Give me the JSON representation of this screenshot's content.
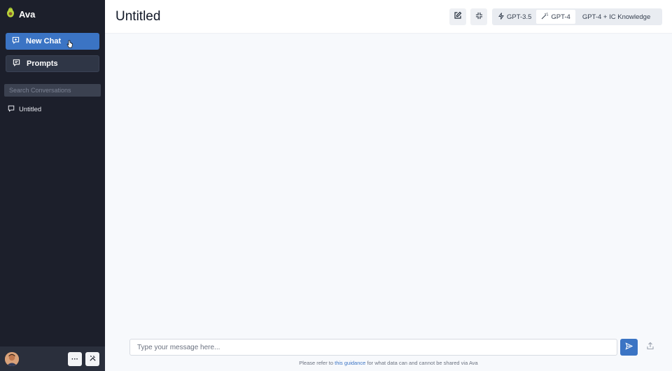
{
  "app": {
    "name": "Ava"
  },
  "sidebar": {
    "new_chat_label": "New Chat",
    "prompts_label": "Prompts",
    "search_placeholder": "Search Conversations",
    "conversations": [
      {
        "title": "Untitled"
      }
    ]
  },
  "footer": {
    "more_label": "···"
  },
  "main": {
    "title": "Untitled",
    "models": [
      {
        "label": "GPT-3.5",
        "icon": "bolt-icon",
        "active": false
      },
      {
        "label": "GPT-4",
        "icon": "magic-wand-icon",
        "active": true
      },
      {
        "label": "GPT-4 + IC Knowledge",
        "icon": "",
        "active": false
      }
    ],
    "composer_placeholder": "Type your message here...",
    "footnote_prefix": "Please refer to",
    "footnote_link": "this guidance",
    "footnote_suffix": "for what data can and cannot be shared via Ava"
  },
  "colors": {
    "sidebar_bg": "#1c1f2b",
    "accent": "#3b74c4",
    "main_bg": "#f7f9fc"
  }
}
